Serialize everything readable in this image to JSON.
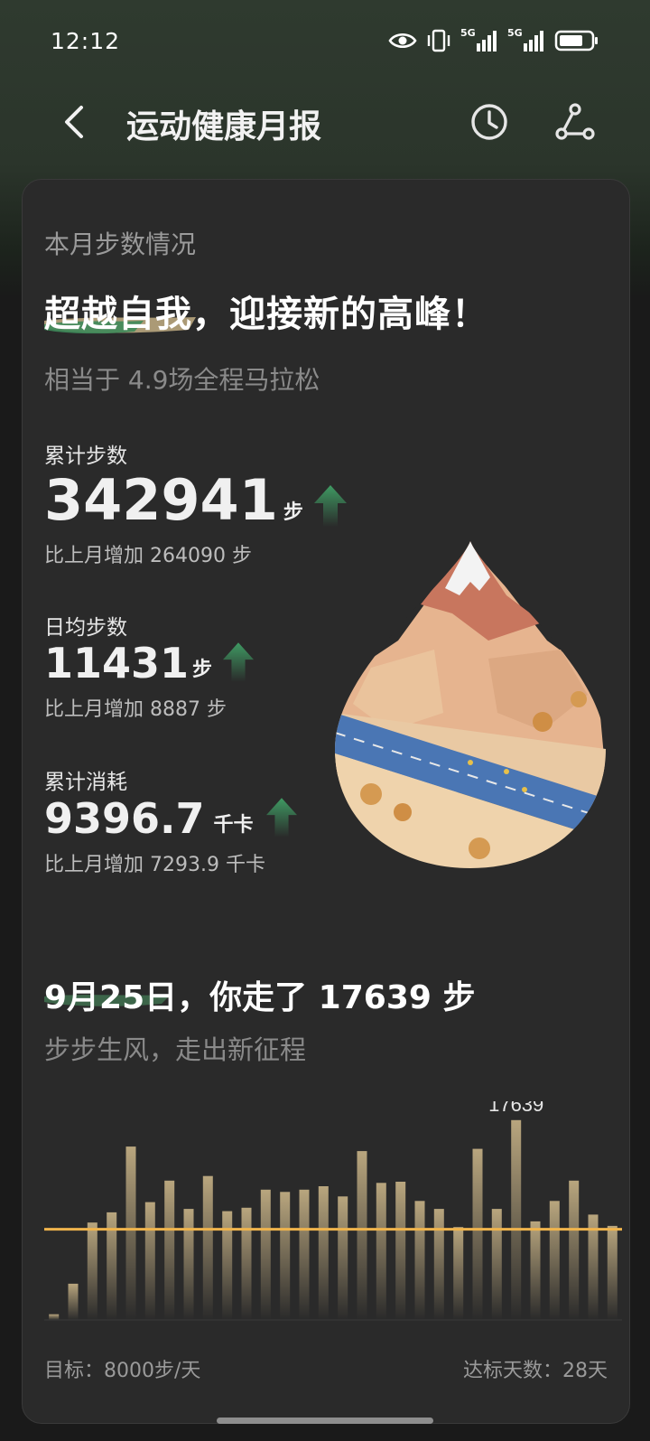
{
  "status_bar": {
    "time": "12:12",
    "signal1": "5G",
    "signal2": "5G",
    "battery_level": 0.75
  },
  "app_bar": {
    "title": "运动健康月报"
  },
  "card": {
    "section_label": "本月步数情况",
    "headline": "超越自我，迎接新的高峰！",
    "subline": "相当于 4.9场全程马拉松",
    "stats": [
      {
        "label": "累计步数",
        "value": "342941",
        "unit": "步",
        "compare": "比上月增加 264090 步",
        "trend": "up"
      },
      {
        "label": "日均步数",
        "value": "11431",
        "unit": "步",
        "compare": "比上月增加 8887 步",
        "trend": "up"
      },
      {
        "label": "累计消耗",
        "value": "9396.7",
        "unit": "千卡",
        "compare": "比上月增加 7293.9 千卡",
        "trend": "up"
      }
    ],
    "day_headline": "9月25日，你走了 17639 步",
    "day_sub": "步步生风，走出新征程",
    "footer_left": "目标：8000步/天",
    "footer_right": "达标天数：28天"
  },
  "chart_data": {
    "type": "bar",
    "values": [
      500,
      3200,
      8600,
      9500,
      15300,
      10400,
      12300,
      9800,
      12700,
      9600,
      9900,
      11500,
      11300,
      11500,
      11800,
      10900,
      14900,
      12100,
      12200,
      10500,
      9800,
      8200,
      15100,
      9800,
      17639,
      8700,
      10500,
      12300,
      9300,
      8300
    ],
    "highlight_value": "17639",
    "highlight_index": 24,
    "goal": 8000,
    "ylim": [
      0,
      18500
    ],
    "colors": {
      "bar_top": "#b9a67e",
      "bar_bottom": "#2a2a2a",
      "goal_line": "#f0b44c"
    }
  }
}
